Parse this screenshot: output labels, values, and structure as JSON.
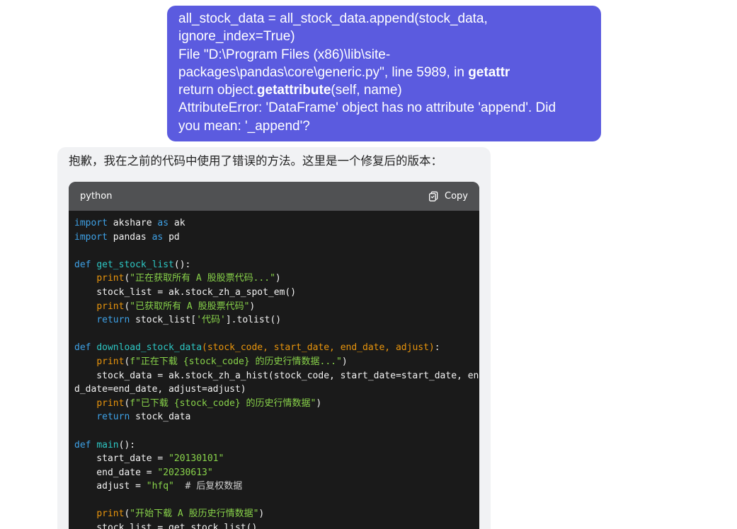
{
  "user_message": {
    "lines": [
      [
        {
          "t": "all_stock_data = all_stock_data.append(stock_data,"
        }
      ],
      [
        {
          "t": "ignore_index=True)"
        }
      ],
      [
        {
          "t": "File \"D:\\Program Files (x86)\\lib\\site-"
        }
      ],
      [
        {
          "t": "packages\\pandas\\core\\generic.py\", line 5989, in "
        },
        {
          "t": "getattr",
          "b": true
        }
      ],
      [
        {
          "t": "return object."
        },
        {
          "t": "getattribute",
          "b": true
        },
        {
          "t": "(self, name)"
        }
      ],
      [
        {
          "t": "AttributeError: 'DataFrame' object has no attribute 'append'. Did"
        }
      ],
      [
        {
          "t": "you mean: '_append'?"
        }
      ]
    ]
  },
  "assistant_message": {
    "text": "抱歉，我在之前的代码中使用了错误的方法。这里是一个修复后的版本：",
    "code_block": {
      "language": "python",
      "copy_label": "Copy",
      "copy_icon": "clipboard-icon",
      "lines": [
        [
          [
            "kw",
            "import"
          ],
          [
            "pl",
            " akshare "
          ],
          [
            "kw",
            "as"
          ],
          [
            "pl",
            " ak"
          ]
        ],
        [
          [
            "kw",
            "import"
          ],
          [
            "pl",
            " pandas "
          ],
          [
            "kw",
            "as"
          ],
          [
            "pl",
            " pd"
          ]
        ],
        [],
        [
          [
            "kw",
            "def"
          ],
          [
            "pl",
            " "
          ],
          [
            "fn",
            "get_stock_list"
          ],
          [
            "pl",
            "():"
          ]
        ],
        [
          [
            "pl",
            "    "
          ],
          [
            "bi",
            "print"
          ],
          [
            "pl",
            "("
          ],
          [
            "str",
            "\"正在获取所有 A 股股票代码...\""
          ],
          [
            "pl",
            ")"
          ]
        ],
        [
          [
            "pl",
            "    stock_list = ak.stock_zh_a_spot_em()"
          ]
        ],
        [
          [
            "pl",
            "    "
          ],
          [
            "bi",
            "print"
          ],
          [
            "pl",
            "("
          ],
          [
            "str",
            "\"已获取所有 A 股股票代码\""
          ],
          [
            "pl",
            ")"
          ]
        ],
        [
          [
            "pl",
            "    "
          ],
          [
            "kw",
            "return"
          ],
          [
            "pl",
            " stock_list["
          ],
          [
            "str",
            "'代码'"
          ],
          [
            "pl",
            "].tolist()"
          ]
        ],
        [],
        [
          [
            "kw",
            "def"
          ],
          [
            "pl",
            " "
          ],
          [
            "fn",
            "download_stock_data"
          ],
          [
            "bi",
            "(stock_code, start_date, end_date, adjust)"
          ],
          [
            "pl",
            ":"
          ]
        ],
        [
          [
            "pl",
            "    "
          ],
          [
            "bi",
            "print"
          ],
          [
            "pl",
            "("
          ],
          [
            "str",
            "f\"正在下载 {stock_code} 的历史行情数据...\""
          ],
          [
            "pl",
            ")"
          ]
        ],
        [
          [
            "pl",
            "    stock_data = ak.stock_zh_a_hist(stock_code, start_date=start_date, en"
          ]
        ],
        [
          [
            "pl",
            "d_date=end_date, adjust=adjust)"
          ]
        ],
        [
          [
            "pl",
            "    "
          ],
          [
            "bi",
            "print"
          ],
          [
            "pl",
            "("
          ],
          [
            "str",
            "f\"已下载 {stock_code} 的历史行情数据\""
          ],
          [
            "pl",
            ")"
          ]
        ],
        [
          [
            "pl",
            "    "
          ],
          [
            "kw",
            "return"
          ],
          [
            "pl",
            " stock_data"
          ]
        ],
        [],
        [
          [
            "kw",
            "def"
          ],
          [
            "pl",
            " "
          ],
          [
            "fn",
            "main"
          ],
          [
            "pl",
            "():"
          ]
        ],
        [
          [
            "pl",
            "    start_date = "
          ],
          [
            "str",
            "\"20130101\""
          ]
        ],
        [
          [
            "pl",
            "    end_date = "
          ],
          [
            "str",
            "\"20230613\""
          ]
        ],
        [
          [
            "pl",
            "    adjust = "
          ],
          [
            "str",
            "\"hfq\""
          ],
          [
            "pl",
            "  "
          ],
          [
            "cm",
            "# 后复权数据"
          ]
        ],
        [],
        [
          [
            "pl",
            "    "
          ],
          [
            "bi",
            "print"
          ],
          [
            "pl",
            "("
          ],
          [
            "str",
            "\"开始下载 A 股历史行情数据\""
          ],
          [
            "pl",
            ")"
          ]
        ],
        [
          [
            "pl",
            "    stock_list = get_stock_list()"
          ]
        ]
      ]
    }
  }
}
